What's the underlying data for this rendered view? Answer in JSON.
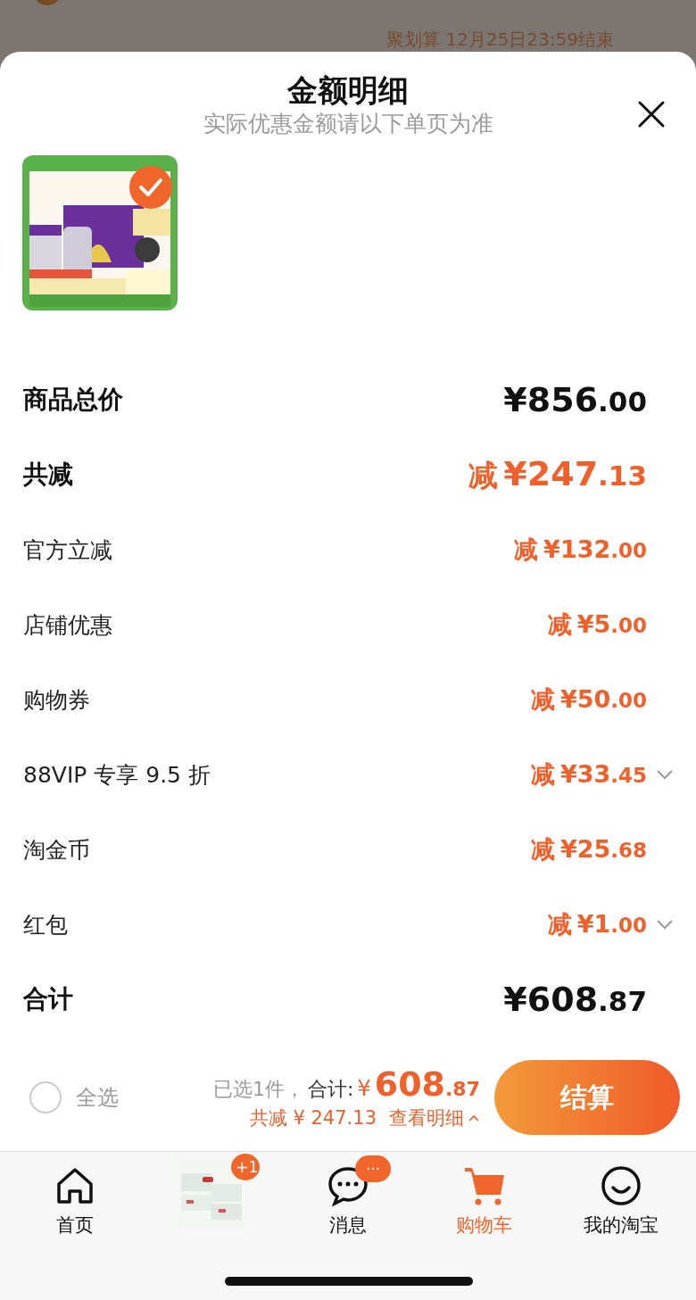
{
  "background": {
    "banner": "聚划算 12月25日23:59结束"
  },
  "sheet": {
    "title": "金额明细",
    "subtitle": "实际优惠金额请以下单页为准"
  },
  "products": [
    {
      "kind": "picture",
      "selected": true
    }
  ],
  "rows": [
    {
      "kind": "total",
      "label": "商品总价",
      "sign": "",
      "amount": "¥856",
      "cents": ".00",
      "expandable": false
    },
    {
      "kind": "summary",
      "label": "共减",
      "sign": "减",
      "amount": "¥247",
      "cents": ".13",
      "expandable": false
    },
    {
      "kind": "discount",
      "label": "官方立减",
      "sign": "减",
      "amount": "¥132",
      "cents": ".00",
      "expandable": false
    },
    {
      "kind": "discount",
      "label": "店铺优惠",
      "sign": "减",
      "amount": "¥5",
      "cents": ".00",
      "expandable": false
    },
    {
      "kind": "discount",
      "label": "购物券",
      "sign": "减",
      "amount": "¥50",
      "cents": ".00",
      "expandable": false
    },
    {
      "kind": "discount",
      "label": "88VIP 专享 9.5 折",
      "sign": "减",
      "amount": "¥33",
      "cents": ".45",
      "expandable": true
    },
    {
      "kind": "discount",
      "label": "淘金币",
      "sign": "减",
      "amount": "¥25",
      "cents": ".68",
      "expandable": false
    },
    {
      "kind": "discount",
      "label": "红包",
      "sign": "减",
      "amount": "¥1",
      "cents": ".00",
      "expandable": true
    },
    {
      "kind": "total",
      "label": "合计",
      "sign": "",
      "amount": "¥608",
      "cents": ".87",
      "expandable": false
    }
  ],
  "checkout": {
    "select_all": {
      "label": "全选",
      "checked": false
    },
    "selected_count": "已选1件，",
    "total_label": "合计:",
    "currency": "¥",
    "total": "608",
    "total_cents": ".87",
    "discount": "共减 ¥ 247.13",
    "details_link": "查看明细",
    "checkout_button": "结算"
  },
  "tab_bar": [
    {
      "kind": "home",
      "label": "首页",
      "selected": false
    },
    {
      "kind": "product",
      "badge": "+1",
      "selected": false
    },
    {
      "kind": "messages",
      "label": "消息",
      "badge": "···",
      "selected": false
    },
    {
      "kind": "cart",
      "label": "购物车",
      "selected": true
    },
    {
      "kind": "profile",
      "label": "我的淘宝",
      "selected": false
    }
  ]
}
